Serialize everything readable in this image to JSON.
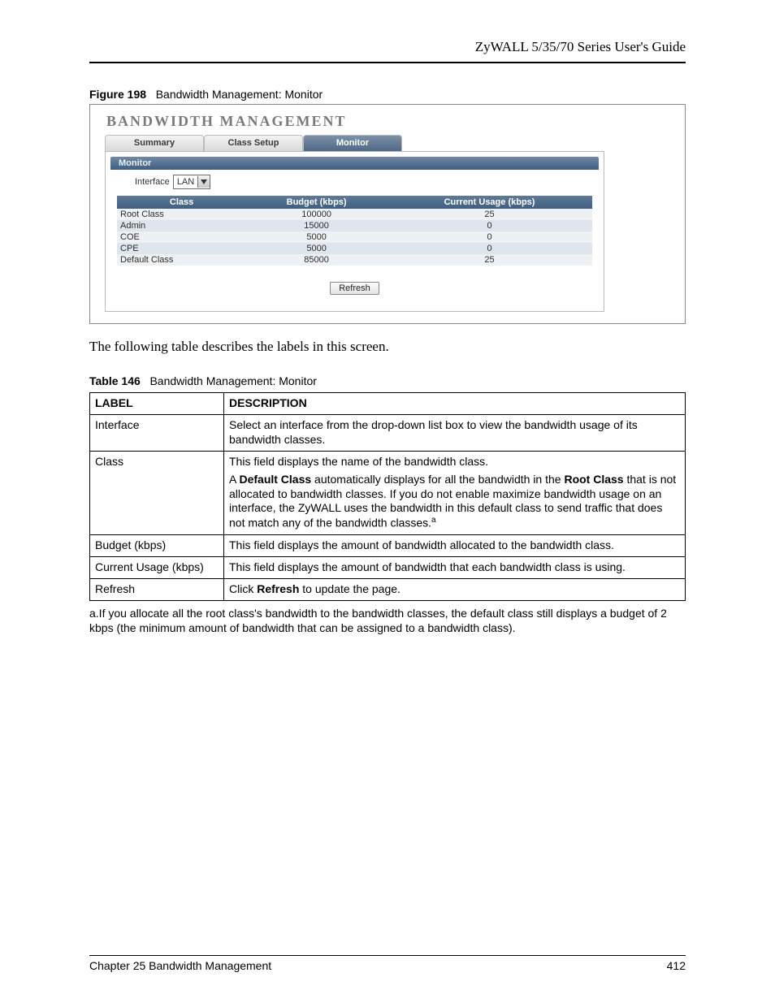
{
  "header": {
    "running": "ZyWALL 5/35/70 Series User's Guide"
  },
  "figure": {
    "label": "Figure 198",
    "title": "Bandwidth Management: Monitor"
  },
  "screenshot": {
    "title": "BANDWIDTH MANAGEMENT",
    "tabs": {
      "summary": "Summary",
      "class_setup": "Class Setup",
      "monitor": "Monitor"
    },
    "section_label": "Monitor",
    "interface_label": "Interface",
    "interface_value": "LAN",
    "columns": {
      "class": "Class",
      "budget": "Budget (kbps)",
      "usage": "Current Usage (kbps)"
    },
    "rows": [
      {
        "class": "Root Class",
        "budget": "100000",
        "usage": "25"
      },
      {
        "class": "Admin",
        "budget": "15000",
        "usage": "0"
      },
      {
        "class": "COE",
        "budget": "5000",
        "usage": "0"
      },
      {
        "class": "CPE",
        "budget": "5000",
        "usage": "0"
      },
      {
        "class": "Default Class",
        "budget": "85000",
        "usage": "25"
      }
    ],
    "refresh": "Refresh"
  },
  "prose": "The following table describes the labels in this screen.",
  "table_caption": {
    "label": "Table 146",
    "title": "Bandwidth Management: Monitor"
  },
  "desc_table": {
    "header_label": "LABEL",
    "header_desc": "DESCRIPTION",
    "interface": {
      "label": "Interface",
      "desc": "Select an interface from the drop-down list box to view the bandwidth usage of its bandwidth classes."
    },
    "class": {
      "label": "Class",
      "p1": "This field displays the name of the bandwidth class.",
      "p2a": "A ",
      "p2b_bold": "Default Class",
      "p2c": " automatically displays for all the bandwidth in the ",
      "p2d_bold": "Root Class",
      "p2e": " that is not allocated to bandwidth classes. If  you do not enable maximize bandwidth usage on an interface, the ZyWALL uses the bandwidth in this default class to send traffic that does not match any of the bandwidth classes.",
      "sup": "a"
    },
    "budget": {
      "label": "Budget (kbps)",
      "desc": "This field displays the amount of bandwidth allocated to the bandwidth class."
    },
    "usage": {
      "label": "Current Usage (kbps)",
      "desc": "This field displays the amount of bandwidth that each bandwidth class is using."
    },
    "refresh": {
      "label": "Refresh",
      "desc_a": "Click ",
      "desc_bold": "Refresh",
      "desc_b": " to update the page."
    }
  },
  "footnote": "a.If you allocate all the root class's bandwidth to the bandwidth classes, the default class still displays a budget of 2 kbps (the minimum amount of bandwidth that can be assigned to a bandwidth class).",
  "footer": {
    "left": "Chapter 25 Bandwidth Management",
    "right": "412"
  }
}
